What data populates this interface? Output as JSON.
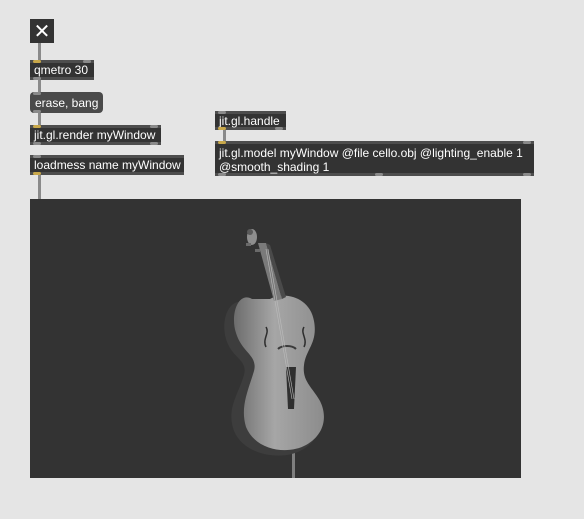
{
  "patcher": {
    "toggle": {
      "icon": "x-icon",
      "state": "on",
      "glyph": "✕"
    },
    "objects": {
      "qmetro": "qmetro 30",
      "message": "erase, bang",
      "render": "jit.gl.render myWindow",
      "loadmess": "loadmess name myWindow",
      "handle": "jit.gl.handle",
      "model": "jit.gl.model myWindow @file cello.obj @lighting_enable 1 @smooth_shading 1"
    },
    "colors": {
      "canvas_bg": "#e5e5e5",
      "object_bg": "#333333",
      "message_bg": "#4a4a4a",
      "window_bg": "#333333",
      "cello": "#9a9a9a",
      "active_port": "#c9a84a"
    }
  }
}
